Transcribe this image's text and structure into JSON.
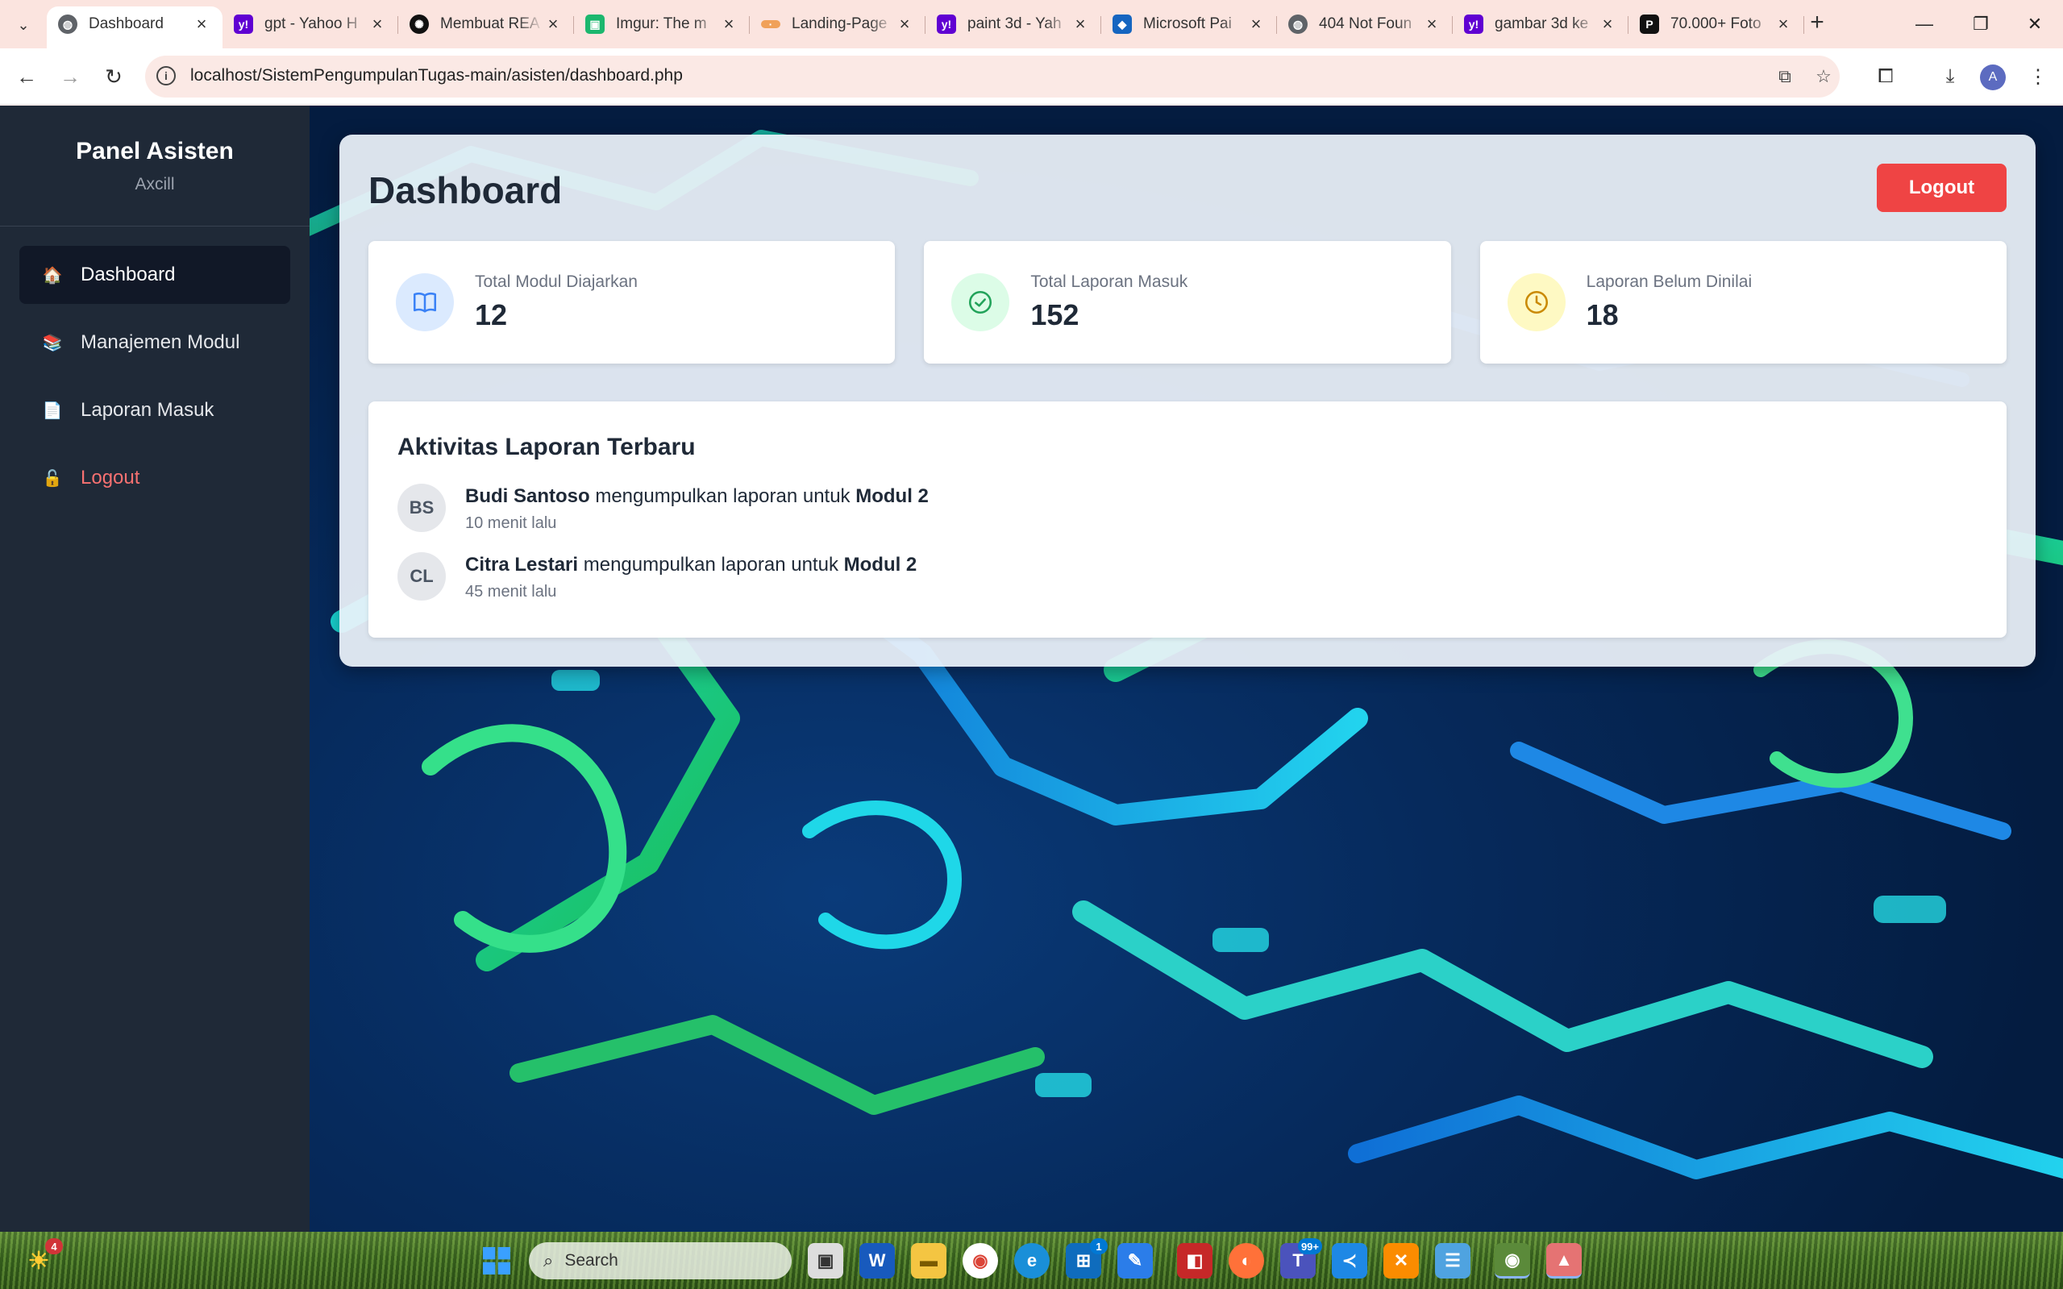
{
  "browser": {
    "tabs": [
      {
        "title": "Dashboard",
        "icon": "globe-icon",
        "active": true
      },
      {
        "title": "gpt - Yahoo H",
        "icon": "yahoo-icon"
      },
      {
        "title": "Membuat REA",
        "icon": "openai-icon"
      },
      {
        "title": "Imgur: The m",
        "icon": "imgur-icon"
      },
      {
        "title": "Landing-Page",
        "icon": "page-icon"
      },
      {
        "title": "paint 3d - Yah",
        "icon": "yahoo-icon"
      },
      {
        "title": "Microsoft Pai",
        "icon": "paint-icon"
      },
      {
        "title": "404 Not Foun",
        "icon": "globe-icon"
      },
      {
        "title": "gambar 3d ke",
        "icon": "yahoo-icon"
      },
      {
        "title": "70.000+ Foto",
        "icon": "pexels-icon"
      }
    ],
    "url": "localhost/SistemPengumpulanTugas-main/asisten/dashboard.php",
    "profile_initial": "A"
  },
  "sidebar": {
    "title": "Panel Asisten",
    "user": "Axcill",
    "items": [
      {
        "label": "Dashboard",
        "icon": "house-icon"
      },
      {
        "label": "Manajemen Modul",
        "icon": "books-icon"
      },
      {
        "label": "Laporan Masuk",
        "icon": "document-icon"
      },
      {
        "label": "Logout",
        "icon": "unlock-icon"
      }
    ]
  },
  "main": {
    "title": "Dashboard",
    "logout_label": "Logout",
    "stats": [
      {
        "label": "Total Modul Diajarkan",
        "value": "12",
        "icon": "book-open-icon",
        "color": "#dbeafe"
      },
      {
        "label": "Total Laporan Masuk",
        "value": "152",
        "icon": "check-circle-icon",
        "color": "#dcfce7"
      },
      {
        "label": "Laporan Belum Dinilai",
        "value": "18",
        "icon": "clock-icon",
        "color": "#fef9c3"
      }
    ],
    "activity": {
      "title": "Aktivitas Laporan Terbaru",
      "items": [
        {
          "initials": "BS",
          "name": "Budi Santoso",
          "text": "mengumpulkan laporan untuk",
          "module": "Modul 2",
          "time": "10 menit lalu"
        },
        {
          "initials": "CL",
          "name": "Citra Lestari",
          "text": "mengumpulkan laporan untuk",
          "module": "Modul 2",
          "time": "45 menit lalu"
        }
      ]
    }
  },
  "taskbar": {
    "search_placeholder": "Search",
    "weather_badge": "4",
    "store_badge": "1",
    "teams_badge": "99+"
  },
  "colors": {
    "sidebar_bg": "#1f2937",
    "logout_red": "#ef4444",
    "tab_strip": "#fbe4df"
  }
}
